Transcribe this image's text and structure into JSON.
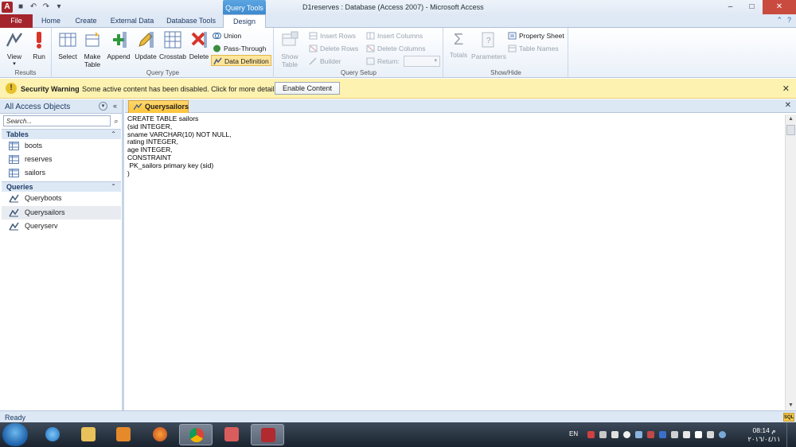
{
  "titlebar": {
    "app_icon_letter": "A",
    "context_tab": "Query Tools",
    "title": "D1reserves : Database (Access 2007)  -  Microsoft Access",
    "minimize": "–",
    "maximize": "□",
    "close": "✕"
  },
  "tabs": {
    "file": "File",
    "home": "Home",
    "create": "Create",
    "external_data": "External Data",
    "database_tools": "Database Tools",
    "design": "Design"
  },
  "ribbon": {
    "results": {
      "label": "Results",
      "view": "View",
      "run": "Run"
    },
    "query_type": {
      "label": "Query Type",
      "select": "Select",
      "make_table_1": "Make",
      "make_table_2": "Table",
      "append": "Append",
      "update": "Update",
      "crosstab": "Crosstab",
      "delete": "Delete",
      "union": "Union",
      "pass_through": "Pass-Through",
      "data_definition": "Data Definition"
    },
    "query_setup": {
      "label": "Query Setup",
      "show_table_1": "Show",
      "show_table_2": "Table",
      "insert_rows": "Insert Rows",
      "delete_rows": "Delete Rows",
      "builder": "Builder",
      "insert_columns": "Insert Columns",
      "delete_columns": "Delete Columns",
      "return": "Return:"
    },
    "show_hide": {
      "label": "Show/Hide",
      "totals": "Totals",
      "parameters": "Parameters",
      "property_sheet": "Property Sheet",
      "table_names": "Table Names"
    }
  },
  "security": {
    "title": "Security Warning",
    "message": "Some active content has been disabled. Click for more details.",
    "button": "Enable Content",
    "close": "✕"
  },
  "nav": {
    "title": "All Access Objects",
    "search_placeholder": "Search...",
    "sections": {
      "tables": "Tables",
      "queries": "Queries"
    },
    "tables": [
      "boots",
      "reserves",
      "sailors"
    ],
    "queries": [
      "Queryboots",
      "Querysailors",
      "Queryserv"
    ]
  },
  "document": {
    "tab": "Querysailors",
    "close": "✕",
    "sql": "CREATE TABLE sailors\n(sid INTEGER,\nsname VARCHAR(10) NOT NULL,\nrating INTEGER,\nage INTEGER,\nCONSTRAINT\n PK_sailors primary key (sid)\n)"
  },
  "status": {
    "text": "Ready",
    "view_button": "SQL"
  },
  "taskbar": {
    "language": "EN",
    "time": "08:14 م",
    "date": "٢٠١٦/٠٤/١١"
  },
  "colors": {
    "file_tab": "#a4262c",
    "security_bar": "#fdf2b0",
    "selected_query_type": "#fde59a",
    "doc_tab": "#fbc43c"
  }
}
